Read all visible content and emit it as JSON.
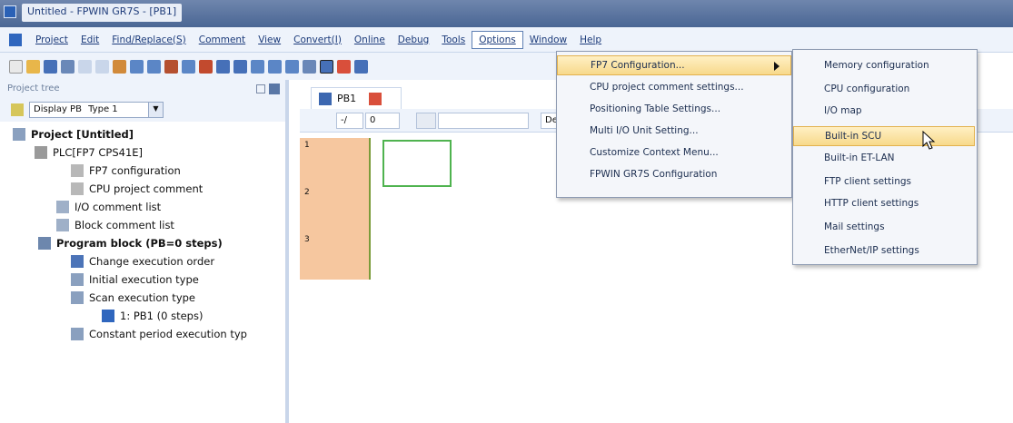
{
  "window": {
    "title": "Untitled - FPWIN GR7S - [PB1]"
  },
  "menubar": {
    "items": [
      "Project",
      "Edit",
      "Find/Replace(S)",
      "Comment",
      "View",
      "Convert(I)",
      "Online",
      "Debug",
      "Tools",
      "Options",
      "Window",
      "Help"
    ],
    "active_index": 9
  },
  "project_tree": {
    "header": "Project tree",
    "filter_label": "Display PB",
    "filter_value": "Type 1",
    "nodes": [
      {
        "label": "Project [Untitled]",
        "bold": true
      },
      {
        "label": "PLC[FP7 CPS41E]",
        "bold": false
      },
      {
        "label": "FP7 configuration",
        "bold": false
      },
      {
        "label": "CPU project comment",
        "bold": false
      },
      {
        "label": "I/O comment list",
        "bold": false
      },
      {
        "label": "Block comment list",
        "bold": false
      },
      {
        "label": "Program block (PB=0 steps)",
        "bold": true
      },
      {
        "label": "Change execution order",
        "bold": false
      },
      {
        "label": "Initial execution type",
        "bold": false
      },
      {
        "label": "Scan execution type",
        "bold": false
      },
      {
        "label": "1: PB1 (0 steps)",
        "bold": false
      },
      {
        "label": "Constant period execution typ",
        "bold": false
      }
    ]
  },
  "editor": {
    "tab_label": "PB1",
    "field_a": "-/",
    "field_b": "0",
    "field_c": "De",
    "rows": [
      "1",
      "2",
      "3"
    ]
  },
  "options_menu": {
    "items": [
      {
        "label": "FP7 Configuration...",
        "has_submenu": true,
        "highlighted": true
      },
      {
        "label": "CPU project comment settings...",
        "has_submenu": false,
        "highlighted": false
      },
      {
        "label": "Positioning Table Settings...",
        "has_submenu": false,
        "highlighted": false
      },
      {
        "label": "Multi I/O Unit Setting...",
        "has_submenu": false,
        "highlighted": false
      },
      {
        "label": "Customize Context Menu...",
        "has_submenu": false,
        "highlighted": false
      },
      {
        "label": "FPWIN GR7S Configuration",
        "has_submenu": false,
        "highlighted": false
      }
    ]
  },
  "fp7_submenu": {
    "items": [
      {
        "label": "Memory configuration",
        "highlighted": false
      },
      {
        "label": "CPU configuration",
        "highlighted": false
      },
      {
        "label": "I/O map",
        "highlighted": false
      },
      {
        "label": "Built-in SCU",
        "highlighted": true
      },
      {
        "label": "Built-in ET-LAN",
        "highlighted": false
      },
      {
        "label": "FTP client settings",
        "highlighted": false
      },
      {
        "label": "HTTP client settings",
        "highlighted": false
      },
      {
        "label": "Mail settings",
        "highlighted": false
      },
      {
        "label": "EtherNet/IP settings",
        "highlighted": false
      }
    ]
  },
  "colors": {
    "highlight": "#f7d98b",
    "ladder_cell": "#f6c79f",
    "cursor": "#4fb34f"
  }
}
